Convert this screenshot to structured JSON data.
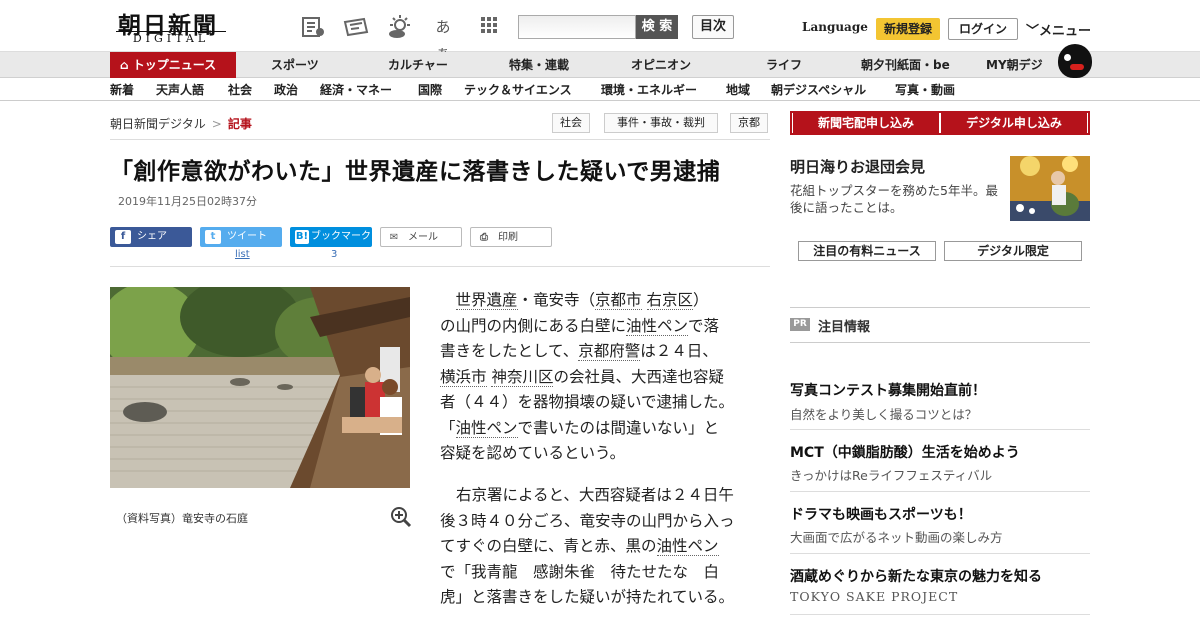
{
  "header": {
    "logo_main": "朝日新聞",
    "logo_sub": "DIGITAL",
    "font_toggle_label": "あぁ",
    "search_placeholder": "",
    "search_button": "検 索",
    "mokuji_button": "目次",
    "language": "Language",
    "register": "新規登録",
    "login": "ログイン",
    "menu": "メニュー"
  },
  "nav_primary": [
    "トップニュース",
    "スポーツ",
    "カルチャー",
    "特集・連載",
    "オピニオン",
    "ライフ",
    "朝夕刊紙面・be",
    "MY朝デジ"
  ],
  "nav_secondary": [
    "新着",
    "天声人語",
    "社会",
    "政治",
    "経済・マネー",
    "国際",
    "テック＆サイエンス",
    "環境・エネルギー",
    "地域",
    "朝デジスペシャル",
    "写真・動画"
  ],
  "breadcrumb": {
    "home": "朝日新聞デジタル",
    "sep": ">",
    "current": "記事"
  },
  "tags": [
    "社会",
    "事件・事故・裁判",
    "京都"
  ],
  "article": {
    "headline": "「創作意欲がわいた」世界遺産に落書きした疑いで男逮捕",
    "date": "2019年11月25日02時37分",
    "caption": "（資料写真）竜安寺の石庭"
  },
  "share": {
    "facebook": "シェア",
    "twitter": "ツイート",
    "hatena": "ブックマーク",
    "mail": "メール",
    "print": "印刷",
    "twitter_sub": "list",
    "hatena_sub": "3"
  },
  "body": {
    "p1": {
      "l1_a": "世界遺産",
      "l1_b": "・竜安寺（",
      "l1_c": "京都市",
      "l1_d": " ",
      "l1_e": "右京区",
      "l1_f": "）",
      "l2_a": "の山門の内側にある白壁に",
      "l2_b": "油性ペン",
      "l2_c": "で落",
      "l3_a": "書きをしたとして、",
      "l3_b": "京都府警",
      "l3_c": "は２４日、",
      "l4_a": "横浜市",
      "l4_b": " ",
      "l4_c": "神奈川区",
      "l4_d": "の会社員、大西達也容疑",
      "l5": "者（４４）を器物損壊の疑いで逮捕した。",
      "l6_a": "「",
      "l6_b": "油性ペン",
      "l6_c": "で書いたのは間違いない」と",
      "l7": "容疑を認めているという。"
    },
    "p2": {
      "l1": "右京署によると、大西容疑者は２４日午",
      "l2": "後３時４０分ごろ、竜安寺の山門から入っ",
      "l3_a": "てすぐの白壁に、青と赤、黒の",
      "l3_b": "油性ペン",
      "l4": "で「我青龍　感謝朱雀　待たせたな　白",
      "l5": "虎」と落書きをした疑いが持たれている。"
    }
  },
  "sidebar": {
    "btn_home_delivery": "新聞宅配申し込み",
    "btn_digital": "デジタル申し込み",
    "promo_title": "明日海りお退団会見",
    "promo_text": "花組トップスターを務めた5年半。最後に語ったことは。",
    "btn_paid_news": "注目の有料ニュース",
    "btn_digital_only": "デジタル限定",
    "pr_badge": "PR",
    "pr_title": "注目情報",
    "ads": [
      {
        "title": "写真コンテスト募集開始直前！",
        "sub": "自然をより美しく撮るコツとは？"
      },
      {
        "title": "MCT（中鎖脂肪酸）生活を始めよう",
        "sub": "きっかけはReライフフェスティバル"
      },
      {
        "title": "ドラマも映画もスポーツも！",
        "sub": "大画面で広がるネット動画の楽しみ方"
      },
      {
        "title": "酒蔵めぐりから新たな東京の魅力を知る",
        "sub": "TOKYO SAKE PROJECT"
      }
    ]
  },
  "colors": {
    "brand_red": "#b5121b",
    "facebook": "#3b5998",
    "twitter": "#55acee",
    "hatena": "#008fde",
    "register_yellow": "#f3c532"
  }
}
